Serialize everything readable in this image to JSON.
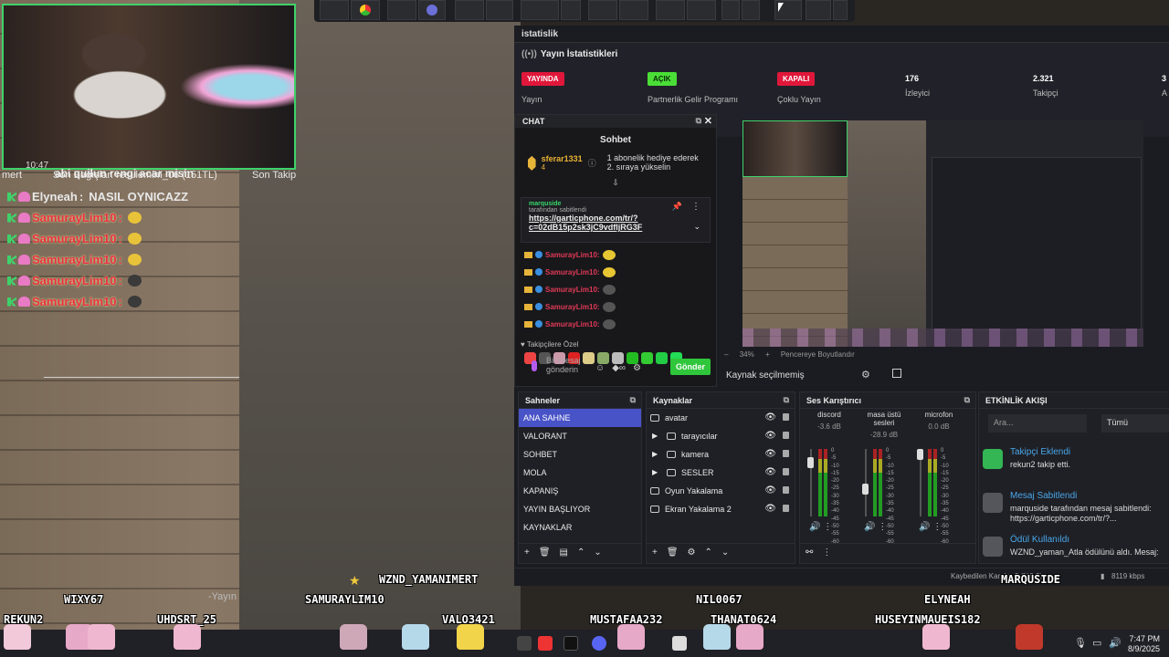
{
  "stream_overlay": {
    "cam_time": "10:47",
    "info_prefix": "mert",
    "last_donation": "Son Bağışlar: resulemim_06 (151TL)",
    "last_follow": "Son Takip",
    "partial_msg": "abi quilun rengi acar misin",
    "chat": [
      {
        "user": "Elyneah",
        "msg": "NASIL OYNICAZZ",
        "emote": false,
        "style": "white"
      },
      {
        "user": "SamurayLim10",
        "msg": "",
        "emote": "yellow",
        "style": "red"
      },
      {
        "user": "SamurayLim10",
        "msg": "",
        "emote": "yellow",
        "style": "red"
      },
      {
        "user": "SamurayLim10",
        "msg": "",
        "emote": "yellow",
        "style": "red"
      },
      {
        "user": "SamurayLim10",
        "msg": "",
        "emote": "dark",
        "style": "red"
      },
      {
        "user": "SamurayLim10",
        "msg": "",
        "emote": "dark",
        "style": "red"
      }
    ],
    "yayin_label": "-Yayın",
    "names": [
      "WIXY67",
      "REKUN2",
      "UHDSRT_25",
      "SAMURAYLIM10",
      "WZND_YAMANIMERT",
      "VALO3421",
      "MUSTAFAA232",
      "NIL0067",
      "THANAT0624",
      "ELYNEAH",
      "HUSEYINMAUEIS182",
      "MARQUSIDE"
    ]
  },
  "obs": {
    "title": "istatislik",
    "stats": {
      "header": "Yayın İstatistikleri",
      "items": [
        {
          "badge": "YAYINDA",
          "label": "Yayın",
          "color": "red"
        },
        {
          "badge": "AÇIK",
          "label": "Partnerlik Gelir Programı",
          "color": "green"
        },
        {
          "badge": "KAPALI",
          "label": "Çoklu Yayın",
          "color": "red"
        },
        {
          "value": "176",
          "label": "İzleyici"
        },
        {
          "value": "2.321",
          "label": "Takipçi"
        },
        {
          "value": "3",
          "label": "A"
        }
      ]
    },
    "chat": {
      "dock_title": "CHAT",
      "heading": "Sohbet",
      "hype_user": "sferar1331",
      "hype_count": "4",
      "hype_text": "1 abonelik hediye ederek 2. sıraya yükselin",
      "pinned_user": "marquside",
      "pinned_by": "tarafından sabitlendi",
      "pinned_link": "https://garticphone.com/tr/?c=02dB15p2sk3jC9vdfljRG3F",
      "lines": [
        "SamurayLim10:",
        "SamurayLim10:",
        "SamurayLim10:",
        "SamurayLim10:",
        "SamurayLim10:"
      ],
      "followers_only": "Takipçilere Özel",
      "input_placeholder": "Bir mesaj gönderin",
      "send_label": "Gönder"
    },
    "preview": {
      "zoom": "34%",
      "fit_label": "Pencereye Boyutlandır",
      "no_source": "Kaynak seçilmemiş"
    },
    "scenes": {
      "title": "Sahneler",
      "items": [
        "ANA SAHNE",
        "VALORANT",
        "SOHBET",
        "MOLA",
        "KAPANIŞ",
        "YAYIN BAŞLIYOR",
        "KAYNAKLAR"
      ],
      "active": 0
    },
    "sources": {
      "title": "Kaynaklar",
      "items": [
        {
          "name": "avatar",
          "group": false,
          "icon": "link"
        },
        {
          "name": "tarayıcılar",
          "group": true,
          "icon": "folder"
        },
        {
          "name": "kamera",
          "group": true,
          "icon": "folder"
        },
        {
          "name": "SESLER",
          "group": true,
          "icon": "folder"
        },
        {
          "name": "Oyun Yakalama",
          "group": false,
          "icon": "gamepad"
        },
        {
          "name": "Ekran Yakalama 2",
          "group": false,
          "icon": "monitor"
        }
      ]
    },
    "mixer": {
      "title": "Ses Karıştırıcı",
      "channels": [
        {
          "name": "discord",
          "db": "-3.6 dB",
          "level": 0.86
        },
        {
          "name": "masa üstü sesleri",
          "db": "-28.9 dB",
          "level": 0.38
        },
        {
          "name": "microfon",
          "db": "0.0 dB",
          "level": 1.0
        }
      ],
      "scale": [
        "0",
        "-5",
        "-10",
        "-15",
        "-20",
        "-25",
        "-30",
        "-35",
        "-40",
        "-45",
        "-50",
        "-55",
        "-60"
      ]
    },
    "events": {
      "title": "ETKİNLİK AKIŞI",
      "search_placeholder": "Ara...",
      "filter": "Tümü",
      "items": [
        {
          "title": "Takipçi Eklendi",
          "desc": [
            "rekun2 takip etti."
          ],
          "color": "#33b653"
        },
        {
          "title": "Mesaj Sabitlendi",
          "desc": [
            "marquside tarafından mesaj sabitlendi:",
            "https://garticphone.com/tr/?..."
          ],
          "color": "#55565c"
        },
        {
          "title": "Ödül Kullanıldı",
          "desc": [
            "WZND_yaman_Atla ödülünü aldı. Mesaj:"
          ],
          "color": "#55565c"
        }
      ]
    },
    "status": {
      "frames": "Kaybedilen Kareler 0 (%0.0)",
      "bitrate": "8119 kbps"
    }
  },
  "taskbar": {
    "time": "7:47 PM",
    "date": "8/9/2025"
  }
}
